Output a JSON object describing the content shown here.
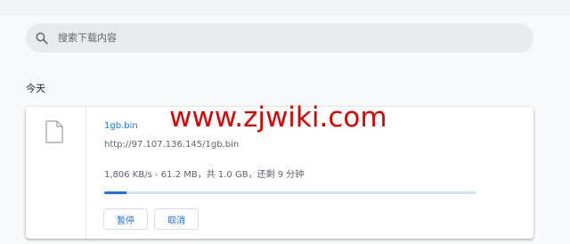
{
  "search": {
    "placeholder": "搜索下载内容"
  },
  "section": {
    "label": "今天"
  },
  "download": {
    "file_name": "1gb.bin",
    "url": "http://97.107.136.145/1gb.bin",
    "status": "1,806 KB/s - 61.2 MB，共 1.0 GB，还剩 9 分钟",
    "progress": 0.06,
    "pause_label": "暂停",
    "cancel_label": "取消"
  },
  "watermark": {
    "text": "www.zjwiki.com"
  },
  "colors": {
    "accent": "#1a73e8",
    "watermark": "#e00000",
    "search_bg": "#e8eaed"
  }
}
